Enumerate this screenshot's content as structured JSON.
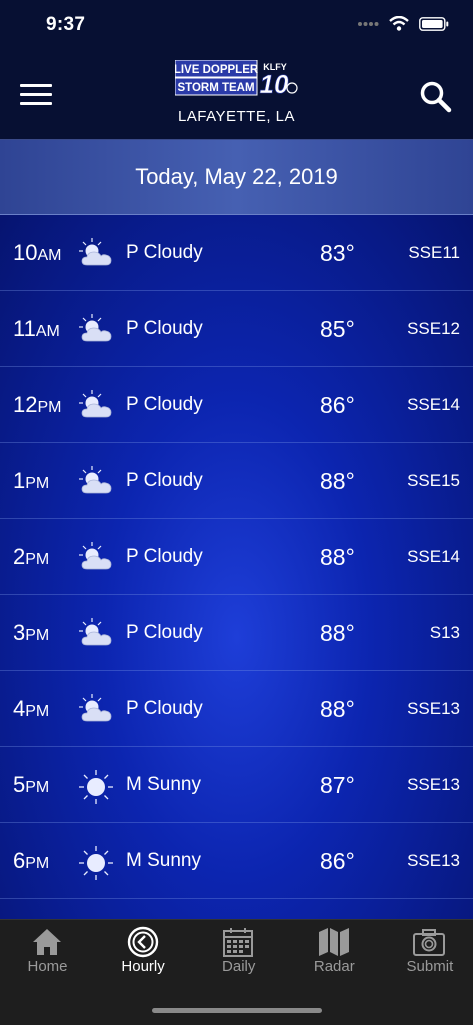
{
  "status": {
    "time": "9:37"
  },
  "header": {
    "logo_line1": "LIVE DOPPLER",
    "logo_line2": "STORM TEAM",
    "logo_call": "KLFY",
    "logo_channel": "10",
    "location": "LAFAYETTE, LA"
  },
  "date_label": "Today, May 22, 2019",
  "hours": [
    {
      "hour": "10",
      "ampm": "AM",
      "icon": "partly-cloudy-icon",
      "condition": "P Cloudy",
      "temp": "83°",
      "wind": "SSE11"
    },
    {
      "hour": "11",
      "ampm": "AM",
      "icon": "partly-cloudy-icon",
      "condition": "P Cloudy",
      "temp": "85°",
      "wind": "SSE12"
    },
    {
      "hour": "12",
      "ampm": "PM",
      "icon": "partly-cloudy-icon",
      "condition": "P Cloudy",
      "temp": "86°",
      "wind": "SSE14"
    },
    {
      "hour": "1",
      "ampm": "PM",
      "icon": "partly-cloudy-icon",
      "condition": "P Cloudy",
      "temp": "88°",
      "wind": "SSE15"
    },
    {
      "hour": "2",
      "ampm": "PM",
      "icon": "partly-cloudy-icon",
      "condition": "P Cloudy",
      "temp": "88°",
      "wind": "SSE14"
    },
    {
      "hour": "3",
      "ampm": "PM",
      "icon": "partly-cloudy-icon",
      "condition": "P Cloudy",
      "temp": "88°",
      "wind": "S13"
    },
    {
      "hour": "4",
      "ampm": "PM",
      "icon": "partly-cloudy-icon",
      "condition": "P Cloudy",
      "temp": "88°",
      "wind": "SSE13"
    },
    {
      "hour": "5",
      "ampm": "PM",
      "icon": "sunny-icon",
      "condition": "M Sunny",
      "temp": "87°",
      "wind": "SSE13"
    },
    {
      "hour": "6",
      "ampm": "PM",
      "icon": "sunny-icon",
      "condition": "M Sunny",
      "temp": "86°",
      "wind": "SSE13"
    }
  ],
  "tabs": [
    {
      "label": "Home",
      "icon": "home-icon",
      "active": false
    },
    {
      "label": "Hourly",
      "icon": "clock-icon",
      "active": true
    },
    {
      "label": "Daily",
      "icon": "calendar-icon",
      "active": false
    },
    {
      "label": "Radar",
      "icon": "map-icon",
      "active": false
    },
    {
      "label": "Submit",
      "icon": "camera-icon",
      "active": false
    }
  ]
}
